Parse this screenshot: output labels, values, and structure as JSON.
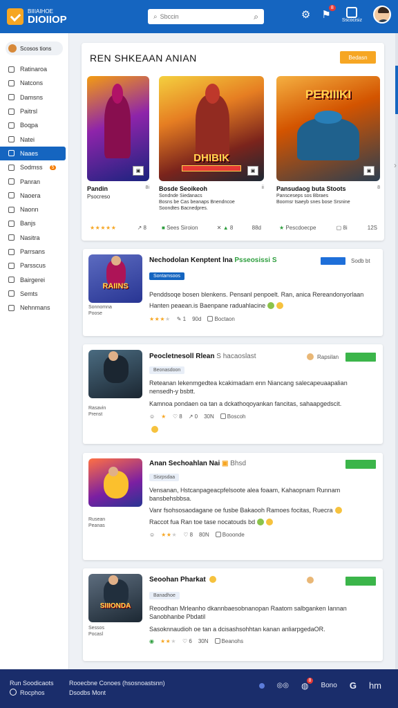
{
  "header": {
    "logo_top": "BIIIAIHOE",
    "logo_main": "DIOIIOP",
    "search_placeholder": "Sbccin",
    "notif_count": "8",
    "user_label": "Sscocisiz"
  },
  "sidebar": {
    "profile": "Scosos tions",
    "items": [
      {
        "label": "Ratinaroa"
      },
      {
        "label": "Natcons"
      },
      {
        "label": "Damsns"
      },
      {
        "label": "Paitrsl"
      },
      {
        "label": "Boqpa"
      },
      {
        "label": "Natei"
      },
      {
        "label": "Naaes",
        "active": true
      },
      {
        "label": "Sodmss",
        "badge": "5"
      },
      {
        "label": "Panran"
      },
      {
        "label": "Naoera"
      },
      {
        "label": "Naonn"
      },
      {
        "label": "Banjs"
      },
      {
        "label": "Nasitra"
      },
      {
        "label": "Parrsans"
      },
      {
        "label": "Parsscus"
      },
      {
        "label": "Bairgerei"
      },
      {
        "label": "Semts"
      },
      {
        "label": "Nehnmans"
      }
    ]
  },
  "featured": {
    "title": "REN SHKEAAN ANIAN",
    "button": "Bedasn",
    "cards": [
      {
        "name": "Pandin",
        "num": "8i",
        "desc": "Psocreso",
        "rating": 5,
        "meta": "8",
        "art_color": "#7b2cbf",
        "art_title": ""
      },
      {
        "name": "Bosde Seoikeoh",
        "num": "ii",
        "desc": "Sondnde Siedanacs\nBosns be Cas beanaps Bnendncoe\nSoondtes Bacnedpres.",
        "rating": 0,
        "meta_left": "Sees Siroion",
        "meta_mid": "8",
        "meta_right": "88d",
        "art_color": "#c0392b",
        "art_title": "DHIBIK"
      },
      {
        "name": "Pansudaog buta Stoots",
        "num": "8",
        "desc": "Pansceseps sos Bbraes\nBoornsr tsaeyb snes bose Srsnine",
        "rating": 0,
        "meta_left": "Pescdoecpe",
        "meta_mid": "8i",
        "meta_right": "12S",
        "art_color": "#e67e22",
        "art_title": "PERIIIKI"
      }
    ]
  },
  "list": [
    {
      "title": "Nechodolan Kenptent lna",
      "title_note": "Psseosissi S",
      "tag": "Sontamsoos",
      "tag_style": "blue",
      "label_right": "Sodb bt",
      "desc1": "Penddsoqe bosen blenkens. Pensanl penpoelt. Ran, anica Rereandonyorlaan",
      "desc2": "Hanten peaean.is Baenpane raduahlacine",
      "rating": 3,
      "stats": [
        "1",
        "90d",
        "Boctaon"
      ],
      "meta_side": [
        "Sonnomna",
        "Poose"
      ],
      "thumb_color": "#3949ab",
      "thumb_title": "RAIINS"
    },
    {
      "title": "Peocletnesoll Rlean",
      "title_note": "S hacaoslast",
      "tag": "Beonasdoon",
      "tag_style": "grey",
      "label_right": "Rapsilan",
      "desc1": "Reteanan lekenmgedtea kcakimadam enn Niancang salecapeuaapalian",
      "desc2": "nensedh-y bsbtt.",
      "desc3": "Kamnoa pondaen oa tan a dckathoqoyankan fancitas, sahaapgedscit.",
      "rating": 1,
      "stats": [
        "8",
        "0",
        "30N",
        "Boscoh"
      ],
      "meta_side": [
        "Rasavin",
        "Prenst"
      ],
      "thumb_color": "#2e6e87",
      "thumb_title": ""
    },
    {
      "title": "Anan Sechoahlan Nai",
      "title_note": "Bhsd",
      "tag": "Sisrpsdaa",
      "tag_style": "grey",
      "label_right": "",
      "desc1": "Vensanan, Hstcanpageacpfelsoote alea foaam, Kahaopnam Runnam",
      "desc2": "bansbehsbbsa.",
      "desc3": "Vanr fsohsosaodagane oe fusbe Bakaooh Ramoes focitas, Ruecra",
      "desc4": "Raccot fua Ran toe tase nocatouds bd",
      "rating": 3,
      "stats": [
        "8",
        "80N",
        "Booonde"
      ],
      "meta_side": [
        "Rusean",
        "Peanas"
      ],
      "thumb_color": "#8e44ad",
      "thumb_title": ""
    },
    {
      "title": "Seoohan Pharkat",
      "title_note": "",
      "tag": "Banadhoe",
      "tag_style": "grey",
      "label_right": "",
      "desc1": "Reoodhan Mrleanho dkannbaesobnanopan Raatom salbganken Iannan",
      "desc2": "Sanobhanbe Pbdatil",
      "desc3": "Sasoknnaudioh oe tan a dcisashsohhtan kanan anliarpgedaOR.",
      "rating": 3,
      "stats": [
        "6",
        "30N",
        "Beanohs"
      ],
      "meta_side": [
        "Sessos",
        "Pocasl"
      ],
      "thumb_color": "#34495e",
      "thumb_title": "SIIIONDA"
    }
  ],
  "footer": {
    "left1": "Run Soodicaots",
    "left2": "Rocphos",
    "mid1": "Rooecbne Conoes (hsosnoastsnn)",
    "mid2": "Dsodbs Mont",
    "right_badge": "8",
    "right_label": "Bono",
    "right_g": "G",
    "right_end": "hm"
  }
}
